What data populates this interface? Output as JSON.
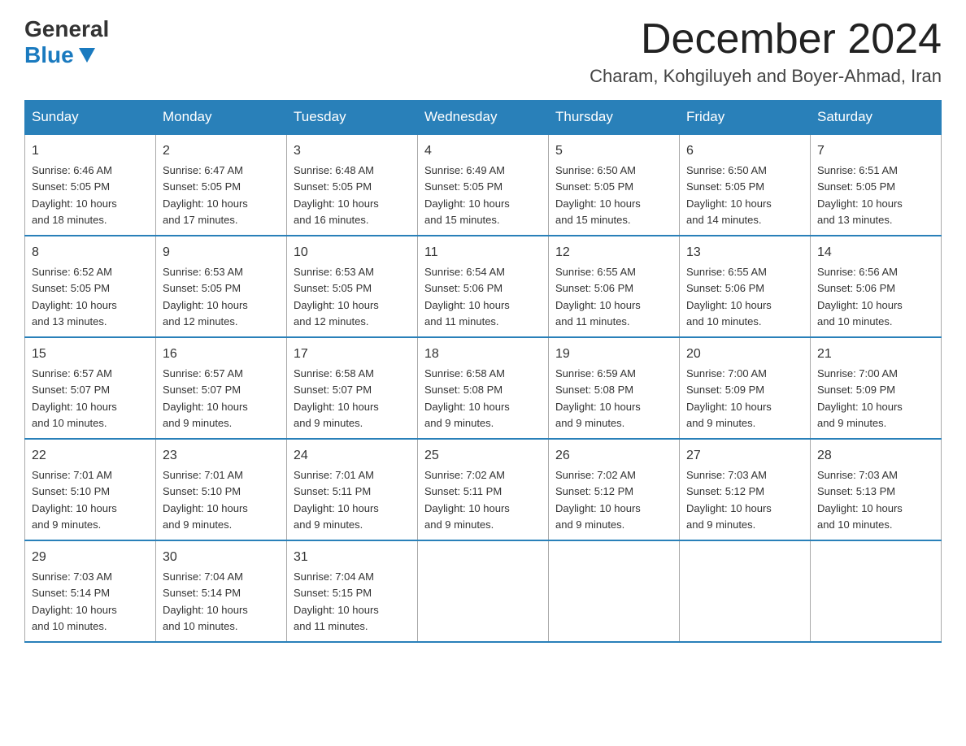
{
  "logo": {
    "general": "General",
    "blue": "Blue"
  },
  "header": {
    "month": "December 2024",
    "location": "Charam, Kohgiluyeh and Boyer-Ahmad, Iran"
  },
  "weekdays": [
    "Sunday",
    "Monday",
    "Tuesday",
    "Wednesday",
    "Thursday",
    "Friday",
    "Saturday"
  ],
  "weeks": [
    [
      {
        "day": "1",
        "sunrise": "6:46 AM",
        "sunset": "5:05 PM",
        "daylight": "10 hours and 18 minutes."
      },
      {
        "day": "2",
        "sunrise": "6:47 AM",
        "sunset": "5:05 PM",
        "daylight": "10 hours and 17 minutes."
      },
      {
        "day": "3",
        "sunrise": "6:48 AM",
        "sunset": "5:05 PM",
        "daylight": "10 hours and 16 minutes."
      },
      {
        "day": "4",
        "sunrise": "6:49 AM",
        "sunset": "5:05 PM",
        "daylight": "10 hours and 15 minutes."
      },
      {
        "day": "5",
        "sunrise": "6:50 AM",
        "sunset": "5:05 PM",
        "daylight": "10 hours and 15 minutes."
      },
      {
        "day": "6",
        "sunrise": "6:50 AM",
        "sunset": "5:05 PM",
        "daylight": "10 hours and 14 minutes."
      },
      {
        "day": "7",
        "sunrise": "6:51 AM",
        "sunset": "5:05 PM",
        "daylight": "10 hours and 13 minutes."
      }
    ],
    [
      {
        "day": "8",
        "sunrise": "6:52 AM",
        "sunset": "5:05 PM",
        "daylight": "10 hours and 13 minutes."
      },
      {
        "day": "9",
        "sunrise": "6:53 AM",
        "sunset": "5:05 PM",
        "daylight": "10 hours and 12 minutes."
      },
      {
        "day": "10",
        "sunrise": "6:53 AM",
        "sunset": "5:05 PM",
        "daylight": "10 hours and 12 minutes."
      },
      {
        "day": "11",
        "sunrise": "6:54 AM",
        "sunset": "5:06 PM",
        "daylight": "10 hours and 11 minutes."
      },
      {
        "day": "12",
        "sunrise": "6:55 AM",
        "sunset": "5:06 PM",
        "daylight": "10 hours and 11 minutes."
      },
      {
        "day": "13",
        "sunrise": "6:55 AM",
        "sunset": "5:06 PM",
        "daylight": "10 hours and 10 minutes."
      },
      {
        "day": "14",
        "sunrise": "6:56 AM",
        "sunset": "5:06 PM",
        "daylight": "10 hours and 10 minutes."
      }
    ],
    [
      {
        "day": "15",
        "sunrise": "6:57 AM",
        "sunset": "5:07 PM",
        "daylight": "10 hours and 10 minutes."
      },
      {
        "day": "16",
        "sunrise": "6:57 AM",
        "sunset": "5:07 PM",
        "daylight": "10 hours and 9 minutes."
      },
      {
        "day": "17",
        "sunrise": "6:58 AM",
        "sunset": "5:07 PM",
        "daylight": "10 hours and 9 minutes."
      },
      {
        "day": "18",
        "sunrise": "6:58 AM",
        "sunset": "5:08 PM",
        "daylight": "10 hours and 9 minutes."
      },
      {
        "day": "19",
        "sunrise": "6:59 AM",
        "sunset": "5:08 PM",
        "daylight": "10 hours and 9 minutes."
      },
      {
        "day": "20",
        "sunrise": "7:00 AM",
        "sunset": "5:09 PM",
        "daylight": "10 hours and 9 minutes."
      },
      {
        "day": "21",
        "sunrise": "7:00 AM",
        "sunset": "5:09 PM",
        "daylight": "10 hours and 9 minutes."
      }
    ],
    [
      {
        "day": "22",
        "sunrise": "7:01 AM",
        "sunset": "5:10 PM",
        "daylight": "10 hours and 9 minutes."
      },
      {
        "day": "23",
        "sunrise": "7:01 AM",
        "sunset": "5:10 PM",
        "daylight": "10 hours and 9 minutes."
      },
      {
        "day": "24",
        "sunrise": "7:01 AM",
        "sunset": "5:11 PM",
        "daylight": "10 hours and 9 minutes."
      },
      {
        "day": "25",
        "sunrise": "7:02 AM",
        "sunset": "5:11 PM",
        "daylight": "10 hours and 9 minutes."
      },
      {
        "day": "26",
        "sunrise": "7:02 AM",
        "sunset": "5:12 PM",
        "daylight": "10 hours and 9 minutes."
      },
      {
        "day": "27",
        "sunrise": "7:03 AM",
        "sunset": "5:12 PM",
        "daylight": "10 hours and 9 minutes."
      },
      {
        "day": "28",
        "sunrise": "7:03 AM",
        "sunset": "5:13 PM",
        "daylight": "10 hours and 10 minutes."
      }
    ],
    [
      {
        "day": "29",
        "sunrise": "7:03 AM",
        "sunset": "5:14 PM",
        "daylight": "10 hours and 10 minutes."
      },
      {
        "day": "30",
        "sunrise": "7:04 AM",
        "sunset": "5:14 PM",
        "daylight": "10 hours and 10 minutes."
      },
      {
        "day": "31",
        "sunrise": "7:04 AM",
        "sunset": "5:15 PM",
        "daylight": "10 hours and 11 minutes."
      },
      null,
      null,
      null,
      null
    ]
  ],
  "labels": {
    "sunrise": "Sunrise:",
    "sunset": "Sunset:",
    "daylight": "Daylight:"
  }
}
